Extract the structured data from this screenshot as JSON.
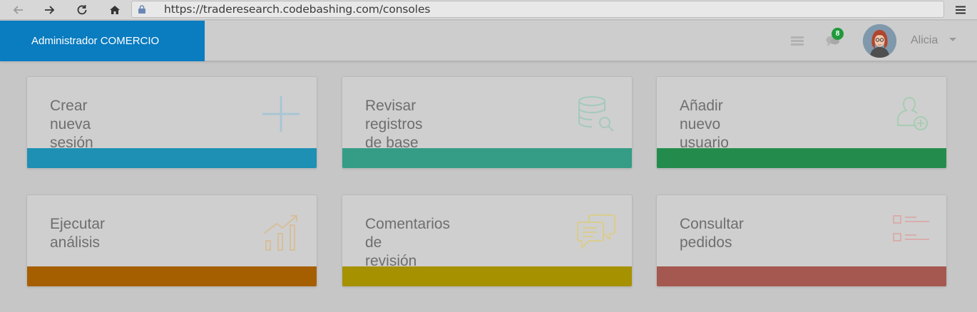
{
  "browser": {
    "url": "https://traderesearch.codebashing.com/consoles",
    "icons": [
      "back-arrow-icon",
      "forward-arrow-icon",
      "reload-icon",
      "home-icon",
      "lock-icon",
      "hamburger-menu-icon"
    ]
  },
  "header": {
    "brand": "Administrador COMERCIO",
    "notification_count": "8",
    "username": "Alicia",
    "icons": [
      "list-icon",
      "chat-bubbles-icon",
      "avatar",
      "caret-down-icon"
    ]
  },
  "cards": [
    {
      "title": "Crear\nnueva\nsesión",
      "icon": "plus-icon",
      "color": "#1d90b3"
    },
    {
      "title": "Revisar\nregistros\nde base\nde datos",
      "icon": "database-search-icon",
      "color": "#359c86"
    },
    {
      "title": "Añadir\nnuevo\nusuario",
      "icon": "add-user-icon",
      "color": "#238c4c"
    },
    {
      "title": "Ejecutar\nanálisis",
      "icon": "bar-chart-icon",
      "color": "#a65f00"
    },
    {
      "title": "Comentarios\nde\nrevisión",
      "icon": "comments-icon",
      "color": "#a69100"
    },
    {
      "title": "Consultar\npedidos",
      "icon": "checklist-icon",
      "color": "#a5584f"
    }
  ]
}
